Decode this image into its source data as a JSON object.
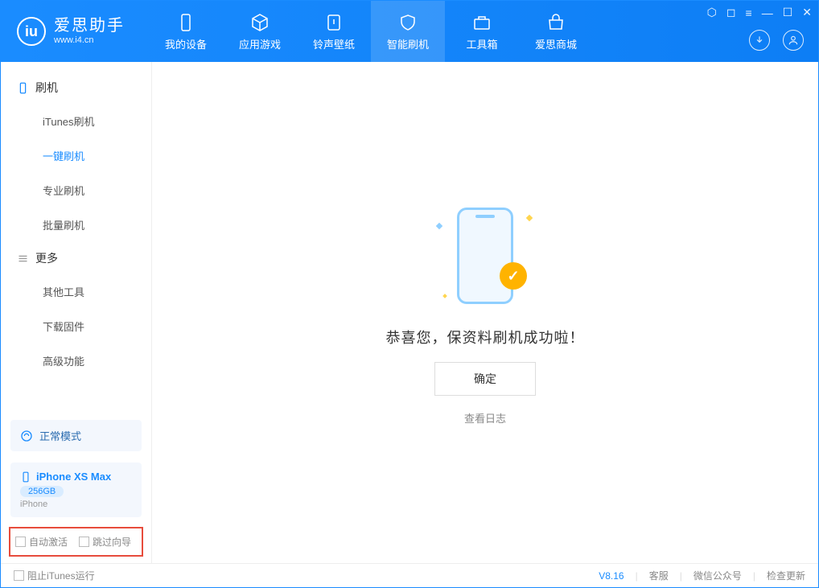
{
  "app": {
    "title": "爱思助手",
    "subtitle": "www.i4.cn"
  },
  "tabs": [
    {
      "label": "我的设备"
    },
    {
      "label": "应用游戏"
    },
    {
      "label": "铃声壁纸"
    },
    {
      "label": "智能刷机"
    },
    {
      "label": "工具箱"
    },
    {
      "label": "爱思商城"
    }
  ],
  "sidebar": {
    "group1_title": "刷机",
    "group1": [
      {
        "label": "iTunes刷机"
      },
      {
        "label": "一键刷机"
      },
      {
        "label": "专业刷机"
      },
      {
        "label": "批量刷机"
      }
    ],
    "group2_title": "更多",
    "group2": [
      {
        "label": "其他工具"
      },
      {
        "label": "下载固件"
      },
      {
        "label": "高级功能"
      }
    ],
    "mode_label": "正常模式",
    "device": {
      "name": "iPhone XS Max",
      "capacity": "256GB",
      "type": "iPhone"
    },
    "checkbox1": "自动激活",
    "checkbox2": "跳过向导"
  },
  "main": {
    "success_text": "恭喜您，保资料刷机成功啦！",
    "ok_button": "确定",
    "log_link": "查看日志"
  },
  "footer": {
    "block_itunes": "阻止iTunes运行",
    "version": "V8.16",
    "support": "客服",
    "wechat": "微信公众号",
    "update": "检查更新"
  }
}
